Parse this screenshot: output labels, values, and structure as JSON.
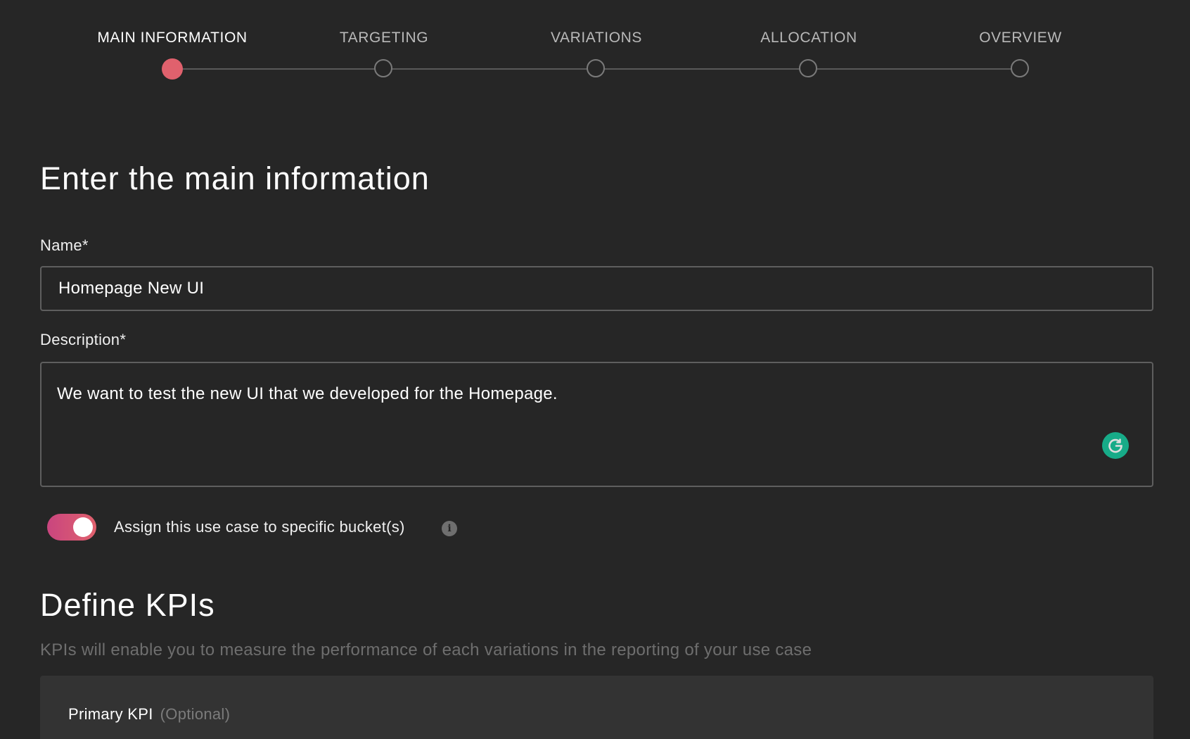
{
  "stepper": {
    "steps": [
      {
        "label": "MAIN INFORMATION",
        "active": true
      },
      {
        "label": "TARGETING",
        "active": false
      },
      {
        "label": "VARIATIONS",
        "active": false
      },
      {
        "label": "ALLOCATION",
        "active": false
      },
      {
        "label": "OVERVIEW",
        "active": false
      }
    ]
  },
  "main_info": {
    "title": "Enter the main information",
    "name_label": "Name*",
    "name_value": "Homepage New UI",
    "description_label": "Description*",
    "description_value": "We want to test the new UI that we developed for the Homepage.",
    "bucket_toggle_label": "Assign this use case to specific bucket(s)",
    "bucket_toggle_on": true,
    "info_icon_glyph": "i"
  },
  "kpis": {
    "title": "Define KPIs",
    "hint": "KPIs will enable you to measure the performance of each variations in the reporting of your use case",
    "primary_label": "Primary KPI",
    "primary_optional": "(Optional)"
  },
  "colors": {
    "background": "#262626",
    "accent": "#e0616d",
    "grammarly": "#15c39a"
  },
  "icons": {
    "grammarly": "grammarly-icon",
    "info": "info-icon"
  }
}
